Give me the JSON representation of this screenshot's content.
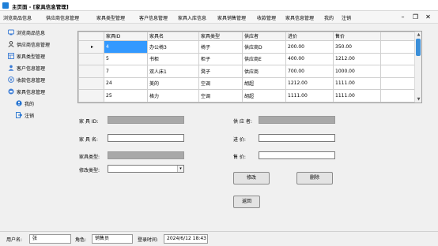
{
  "window": {
    "title": "主页面 - [家具信息管理]"
  },
  "menu": [
    "浏览商品信息",
    "供应商信息管理",
    "家具类型管理",
    "客户信息管理",
    "家具入库信息",
    "家具销售管理",
    "收款管理",
    "家具信息管理",
    "我的",
    "注销"
  ],
  "window_controls": {
    "minimize": "–",
    "restore": "❐",
    "close": "✕"
  },
  "sidebar": [
    {
      "label": "浏览商品信息",
      "icon": "browse-icon"
    },
    {
      "label": "供应商信息管理",
      "icon": "supplier-icon"
    },
    {
      "label": "家具类型管理",
      "icon": "furniture-type-icon"
    },
    {
      "label": "客户信息管理",
      "icon": "customer-icon"
    },
    {
      "label": "收款信息管理",
      "icon": "payment-icon"
    },
    {
      "label": "家具信息管理",
      "icon": "furniture-icon"
    },
    {
      "label": "我的",
      "icon": "user-icon"
    },
    {
      "label": "注销",
      "icon": "logout-icon"
    }
  ],
  "grid": {
    "columns": [
      "家具ID",
      "家具名",
      "家具类型",
      "供应者",
      "进价",
      "售价"
    ],
    "rows": [
      {
        "marker": "▸",
        "cells": [
          "4",
          "办公椅3",
          "椅子",
          "供应商D",
          "200.00",
          "350.00"
        ]
      },
      {
        "marker": "",
        "cells": [
          "5",
          "书柜",
          "柜子",
          "供应商E",
          "400.00",
          "1212.00"
        ]
      },
      {
        "marker": "",
        "cells": [
          "7",
          "双人床1",
          "凳子",
          "供应商",
          "700.00",
          "1000.00"
        ]
      },
      {
        "marker": "",
        "cells": [
          "24",
          "美的",
          "空调",
          "胡超",
          "1212.00",
          "1111.00"
        ]
      },
      {
        "marker": "",
        "cells": [
          "25",
          "格力",
          "空调",
          "胡超",
          "1111.00",
          "1111.00"
        ]
      }
    ]
  },
  "form": {
    "id_label": "家 具 ID:",
    "name_label": "家 具 名:",
    "type_label": "家具类型:",
    "modify_type_label": "修改类型:",
    "supplier_label": "供 应 者:",
    "purchase_label": "进    价:",
    "sale_label": "售    价:",
    "id_value": "",
    "name_value": "",
    "type_value": "",
    "modify_type_value": "",
    "supplier_value": "",
    "purchase_value": "",
    "sale_value": "",
    "dropdown_glyph": "▾"
  },
  "buttons": {
    "modify": "修改",
    "delete": "删除",
    "back": "返回"
  },
  "status": {
    "user_label": "用户名:",
    "user_value": "张",
    "role_label": "角色:",
    "role_value": "销售员",
    "time_label": "登录时间:",
    "time_value": "2024/6/12 18:43"
  },
  "colors": {
    "selection": "#3399ff",
    "readonly_field": "#a8a8a8",
    "accent": "#1e7fd8"
  }
}
